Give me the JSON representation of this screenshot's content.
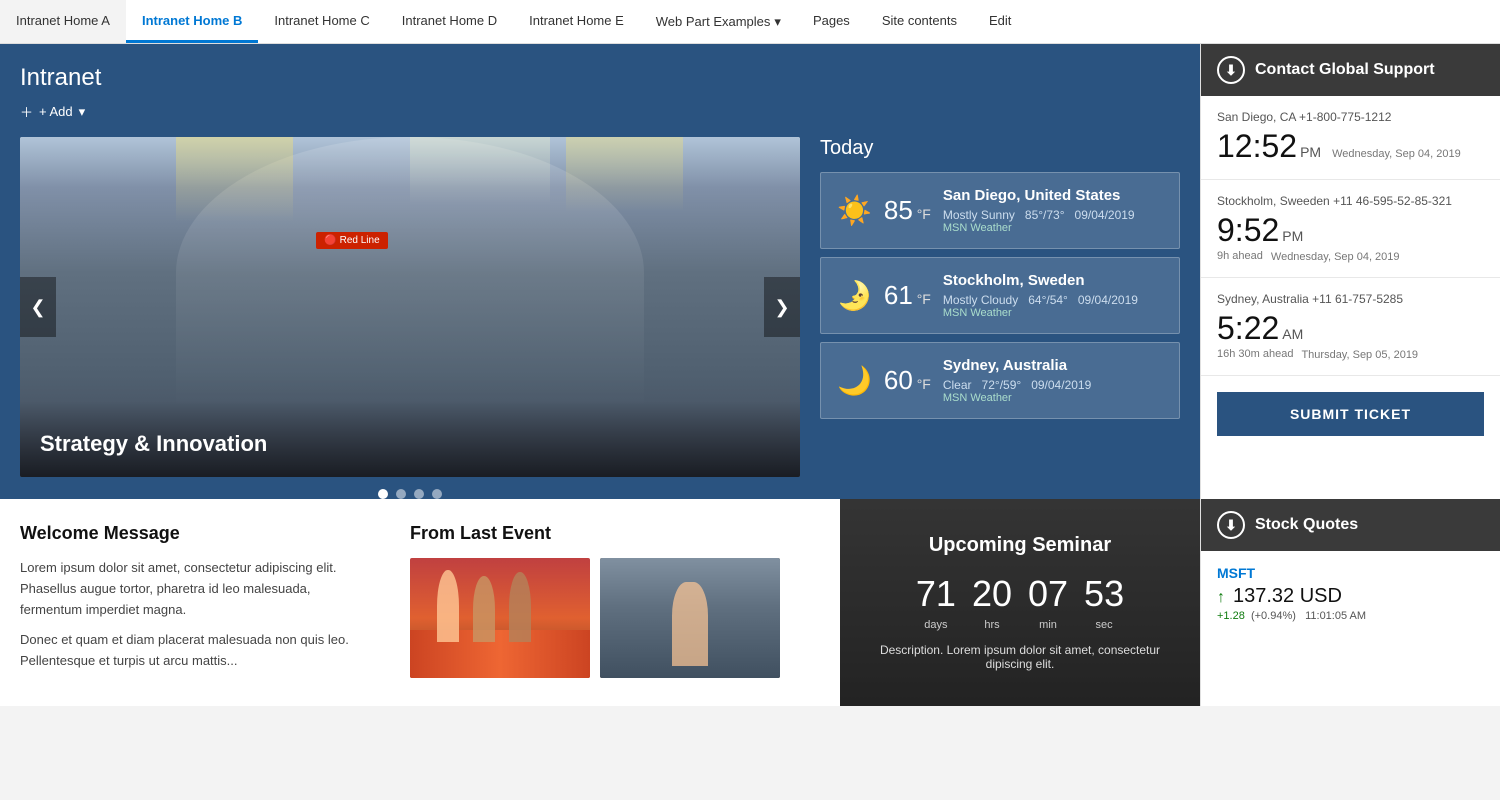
{
  "nav": {
    "items": [
      {
        "label": "Intranet Home A",
        "active": false
      },
      {
        "label": "Intranet Home B",
        "active": true
      },
      {
        "label": "Intranet Home C",
        "active": false
      },
      {
        "label": "Intranet Home D",
        "active": false
      },
      {
        "label": "Intranet Home E",
        "active": false
      },
      {
        "label": "Web Part Examples",
        "active": false,
        "dropdown": true
      },
      {
        "label": "Pages",
        "active": false
      },
      {
        "label": "Site contents",
        "active": false
      },
      {
        "label": "Edit",
        "active": false
      }
    ]
  },
  "page": {
    "title": "Intranet",
    "add_label": "+ Add"
  },
  "carousel": {
    "caption": "Strategy & Innovation",
    "prev_label": "❮",
    "next_label": "❯",
    "dots": [
      true,
      false,
      false,
      false
    ]
  },
  "today": {
    "title": "Today",
    "locations": [
      {
        "city": "San Diego, United States",
        "icon": "☀️",
        "temp": "85",
        "unit": "°F",
        "condition": "Mostly Sunny",
        "range": "85°/73°",
        "date": "09/04/2019",
        "source": "MSN Weather"
      },
      {
        "city": "Stockholm, Sweden",
        "icon": "🌙",
        "temp": "61",
        "unit": "°F",
        "condition": "Mostly Cloudy",
        "range": "64°/54°",
        "date": "09/04/2019",
        "source": "MSN Weather"
      },
      {
        "city": "Sydney, Australia",
        "icon": "🌙",
        "temp": "60",
        "unit": "°F",
        "condition": "Clear",
        "range": "72°/59°",
        "date": "09/04/2019",
        "source": "MSN Weather"
      }
    ]
  },
  "support_widget": {
    "title": "Contact Global Support",
    "clocks": [
      {
        "location": "San Diego, CA +1-800-775-1212",
        "time": "12:52",
        "ampm": "PM",
        "date": "Wednesday, Sep 04, 2019",
        "offset": ""
      },
      {
        "location": "Stockholm, Sweeden +11 46-595-52-85-321",
        "time": "9:52",
        "ampm": "PM",
        "date": "Wednesday, Sep 04, 2019",
        "offset": "9h ahead"
      },
      {
        "location": "Sydney, Australia +11 61-757-5285",
        "time": "5:22",
        "ampm": "AM",
        "date": "Thursday, Sep 05, 2019",
        "offset": "16h 30m ahead"
      }
    ],
    "submit_button": "SUBMIT TICKET"
  },
  "welcome": {
    "title": "Welcome Message",
    "para1": "Lorem ipsum dolor sit amet, consectetur adipiscing elit. Phasellus augue tortor, pharetra id leo malesuada, fermentum imperdiet magna.",
    "para2": "Donec et quam et diam placerat malesuada non quis leo. Pellentesque et turpis ut arcu mattis..."
  },
  "events": {
    "title": "From Last Event"
  },
  "seminar": {
    "title": "Upcoming Seminar",
    "countdown": {
      "days": "71",
      "hours": "20",
      "minutes": "07",
      "seconds": "53"
    },
    "description": "Description. Lorem ipsum dolor sit amet, consectetur dipiscing elit."
  },
  "stocks": {
    "title": "Stock Quotes",
    "items": [
      {
        "ticker": "MSFT",
        "price": "137.32 USD",
        "change": "+1.28",
        "change_pct": "(+0.94%)",
        "time": "11:01:05 AM",
        "up": true
      }
    ]
  }
}
